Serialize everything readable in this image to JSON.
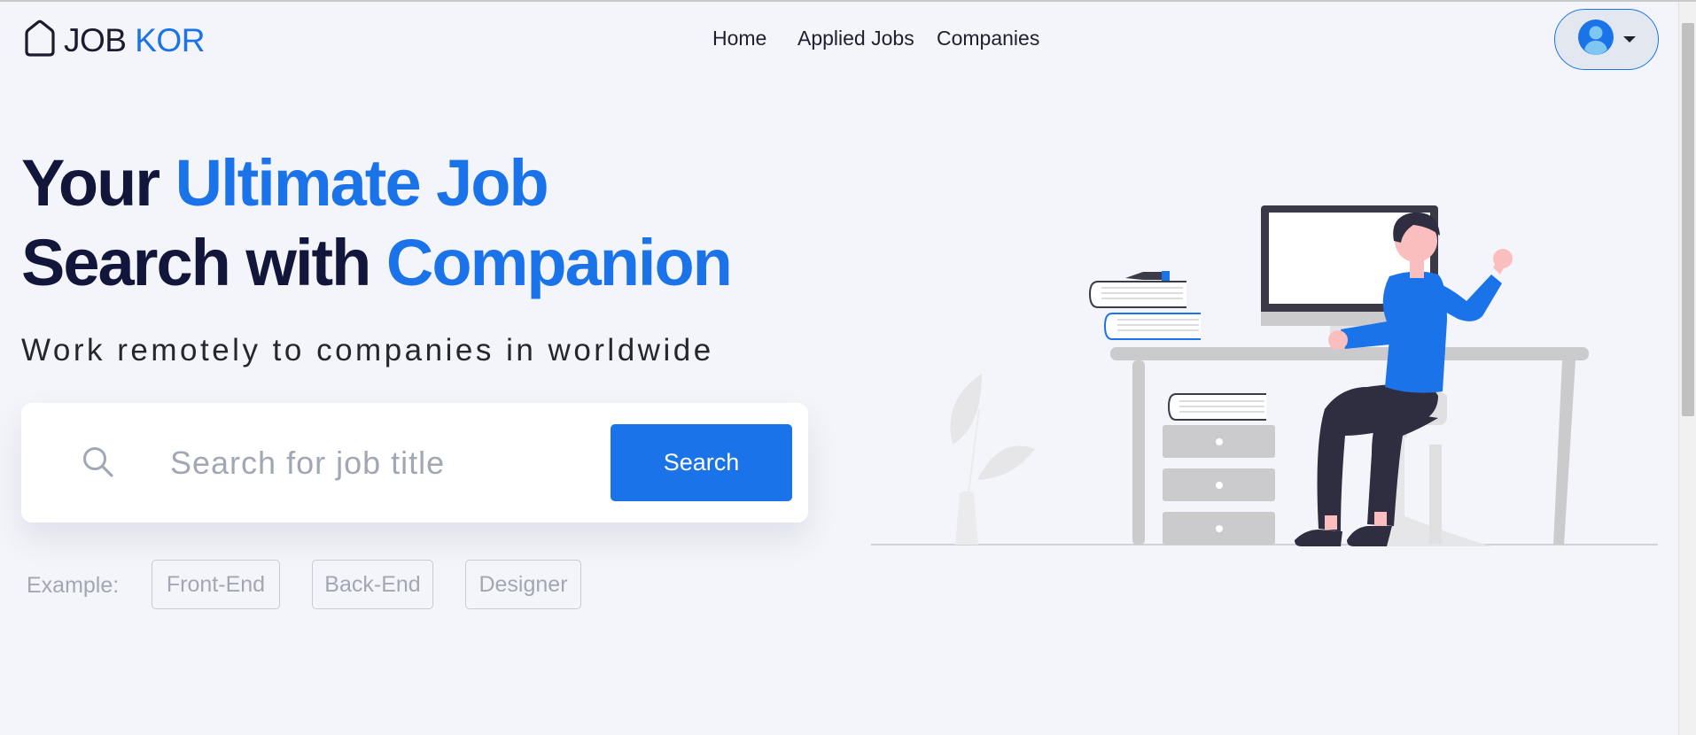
{
  "brand": {
    "part1": "JOB",
    "part2": "KOR"
  },
  "nav": {
    "home": "Home",
    "applied": "Applied Jobs",
    "companies": "Companies"
  },
  "hero": {
    "line1_a": "Your",
    "line1_b": "Ultimate Job",
    "line2_a": "Search with",
    "line2_b": "Companion",
    "subtitle": "Work remotely to companies in worldwide"
  },
  "search": {
    "placeholder": "Search for job title",
    "value": "",
    "button": "Search"
  },
  "examples": {
    "label": "Example:",
    "tags": [
      "Front-End",
      "Back-End",
      "Designer"
    ]
  },
  "colors": {
    "accent": "#1a73e8",
    "heading": "#12163a",
    "background": "#f4f5fa",
    "muted": "#a3a7b3"
  },
  "icons": {
    "logo": "house-outline-icon",
    "profile": "user-avatar-icon",
    "dropdown": "caret-down-icon",
    "search": "magnifier-icon"
  }
}
